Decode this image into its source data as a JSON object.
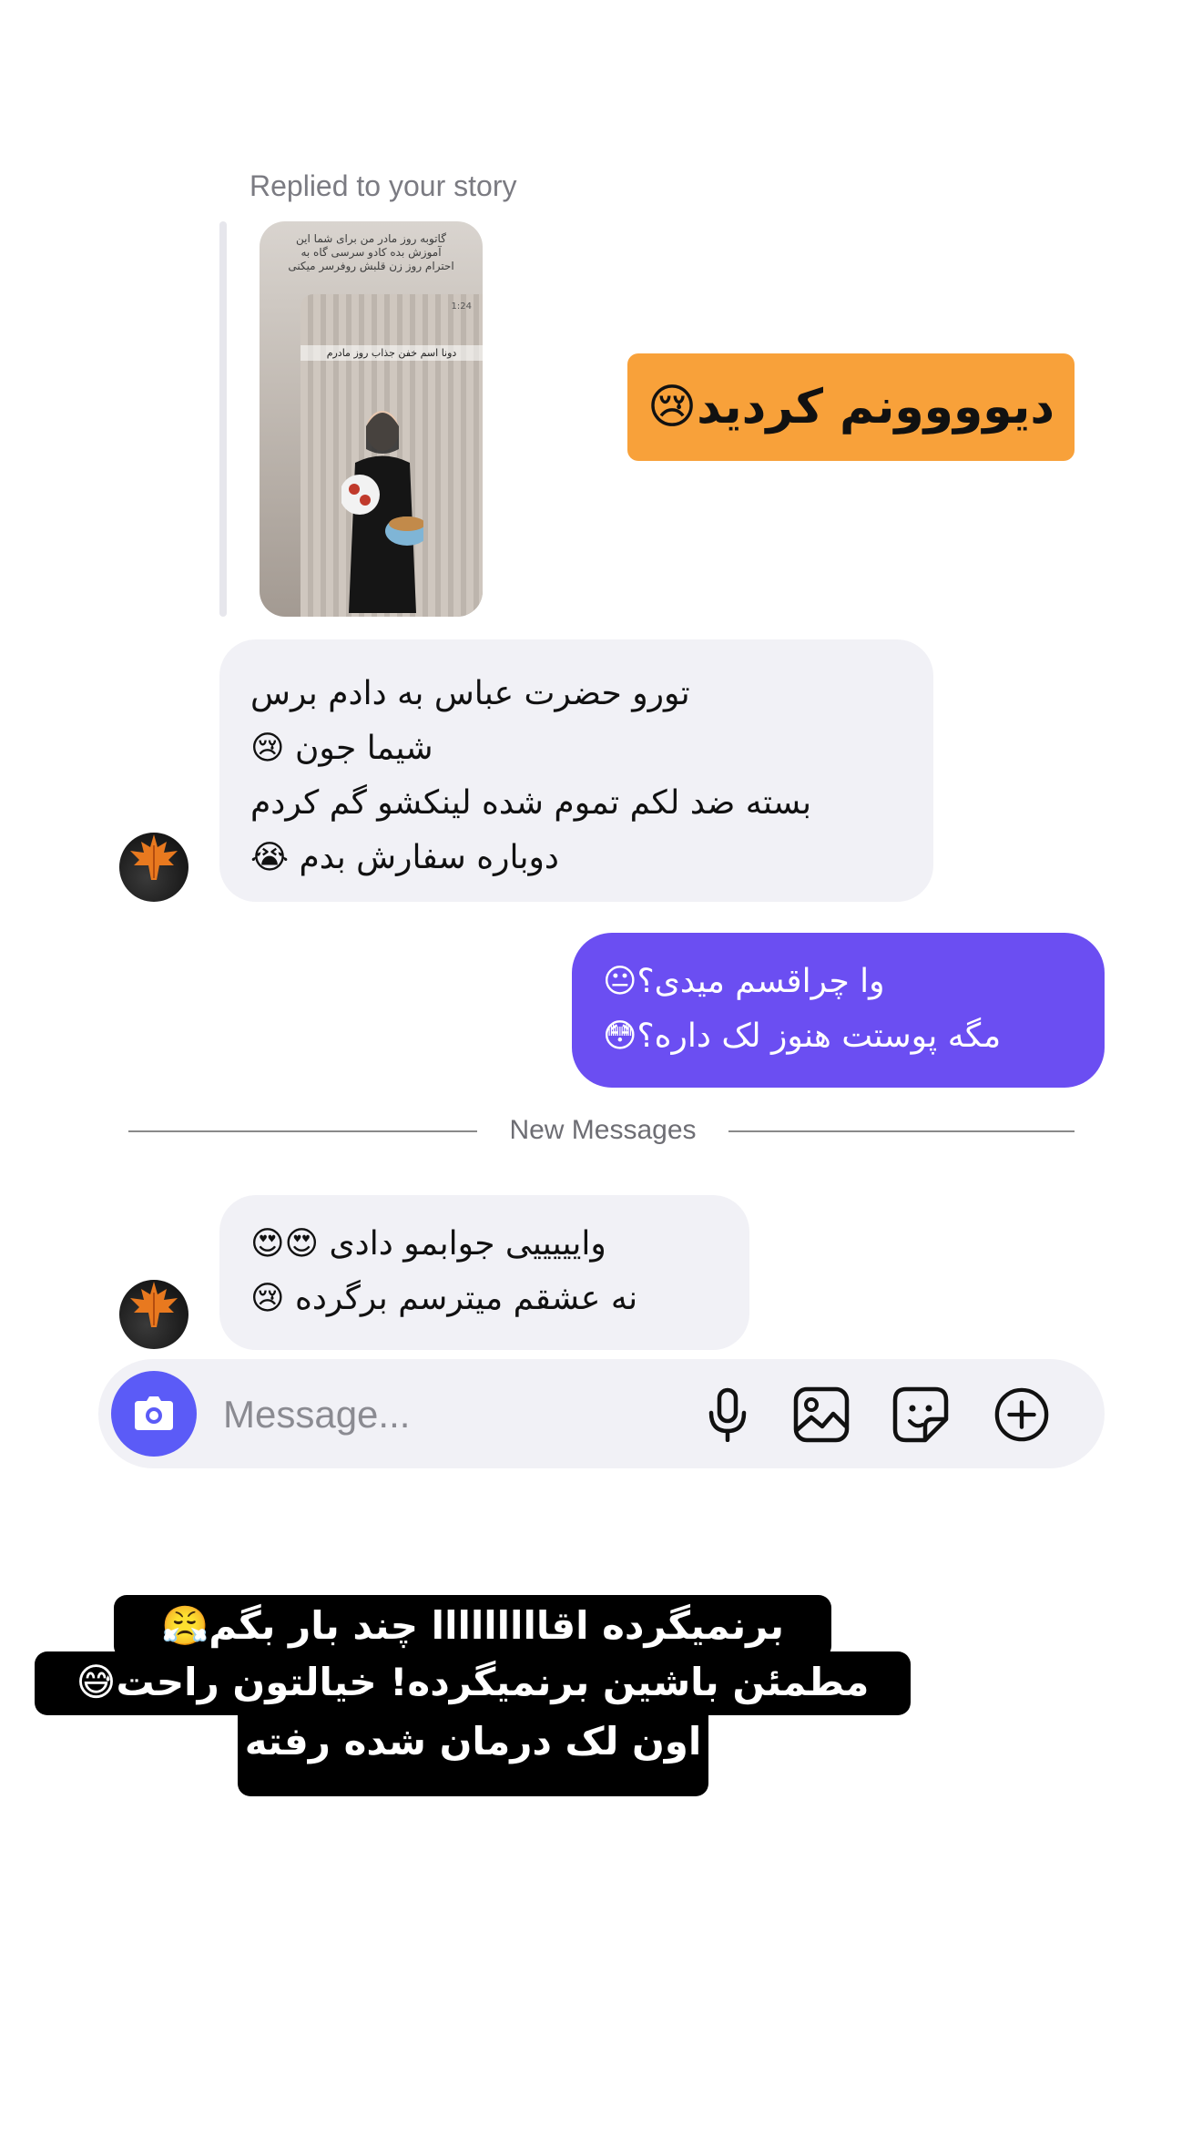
{
  "story_reply": {
    "label": "Replied to your story",
    "thumbnail": {
      "caption": "گاتوبه روز مادر من برای شما این آموزش بده کادو سرسی گاه به احترام روز زن قلبش روفرسر میکنی",
      "inner_time": "1:24",
      "inner_caption": "دونا اسم خفن جذاب روز مادرم"
    }
  },
  "sticker_reply": {
    "text": "دیوووونم کردید😢"
  },
  "messages": [
    {
      "direction": "incoming",
      "lines": [
        "تورو حضرت عباس به دادم برس",
        "شیما جون 😢",
        "بسته ضد لکم تموم شده لینکشو گم کردم",
        "دوباره سفارش بدم 😭"
      ]
    },
    {
      "direction": "outgoing",
      "lines": [
        "وا چراقسم میدی؟😐",
        "مگه پوستت هنوز لک داره؟😳"
      ]
    },
    {
      "direction": "incoming",
      "lines": [
        "وایییییی جوابمو دادی 😍😍",
        "نه عشقم میترسم برگرده 😢"
      ]
    }
  ],
  "divider": {
    "label": "New Messages"
  },
  "composer": {
    "placeholder": "Message...",
    "icons": [
      "camera-icon",
      "microphone-icon",
      "image-icon",
      "sticker-icon",
      "add-icon"
    ],
    "accent": "#5b5bf7"
  },
  "overlay_text": [
    "برنمیگرده اقااااااااا چند بار بگم😤",
    "مطمئن باشین برنمیگرده! خیالتون راحت😅",
    "اون لک درمان شده رفته"
  ],
  "colors": {
    "outgoing_bubble": "#6b4ef2",
    "incoming_bubble": "#f1f1f6",
    "sticker_bg": "#f8a13a"
  }
}
